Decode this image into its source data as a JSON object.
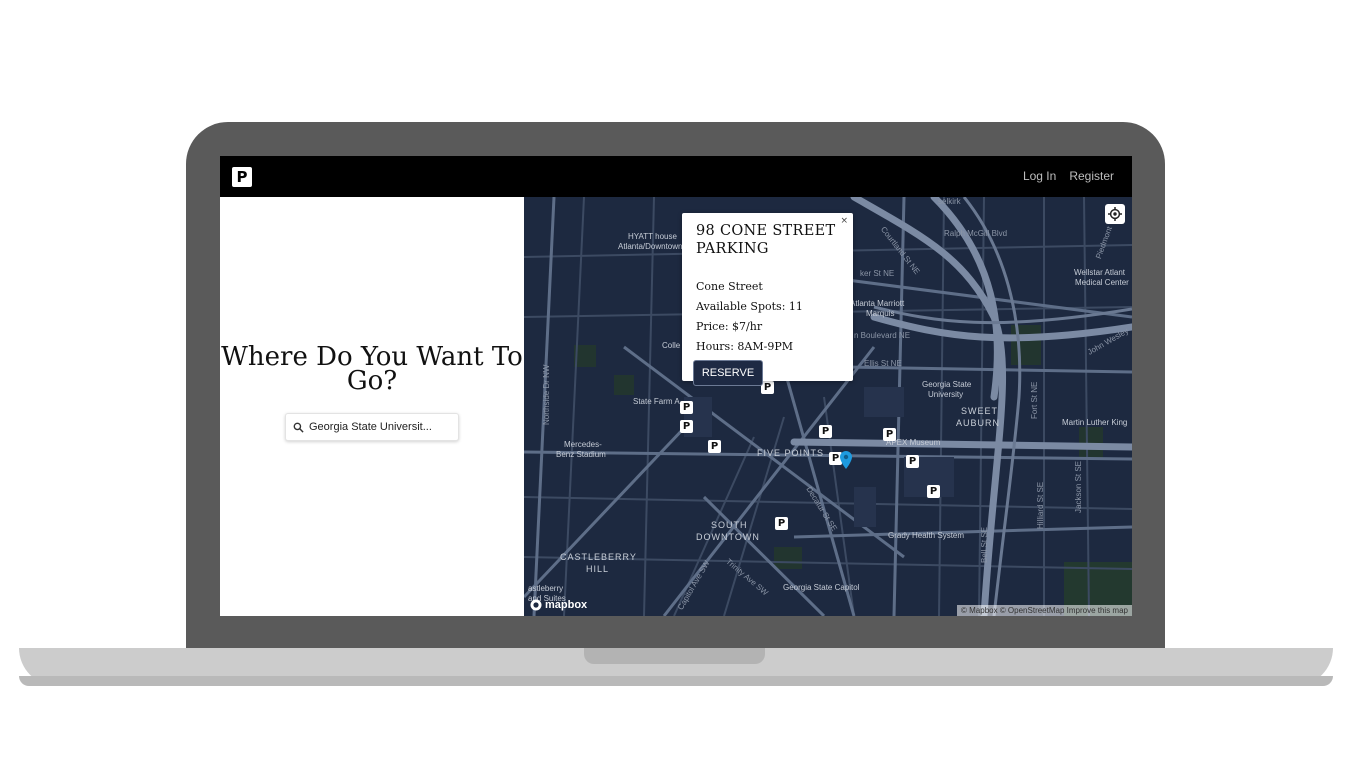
{
  "navbar": {
    "logo_letter": "P",
    "login_label": "Log In",
    "register_label": "Register"
  },
  "search": {
    "headline": "Where Do You Want To Go?",
    "value": "Georgia State Universit...",
    "placeholder": ""
  },
  "popup": {
    "close_symbol": "×",
    "title": "98 CONE STREET PARKING",
    "street": "Cone Street",
    "available_spots": "Available Spots: 11",
    "price": "Price: $7/hr",
    "hours": "Hours: 8AM-9PM",
    "reserve_label": "RESERVE"
  },
  "map": {
    "parking_marker_letter": "P",
    "labels": {
      "five_points": "FIVE POINTS",
      "sweet_auburn_1": "SWEET",
      "sweet_auburn_2": "AUBURN",
      "south_downtown_1": "SOUTH",
      "south_downtown_2": "DOWNTOWN",
      "castleberry_1": "CASTLEBERRY",
      "castleberry_2": "HILL",
      "hyatt_1": "HYATT house",
      "hyatt_2": "Atlanta/Downtown",
      "state_farm": "State Farm A",
      "mercedes_1": "Mercedes-",
      "mercedes_2": "Benz Stadium",
      "marriott_1": "Atlanta Marriott",
      "marriott_2": "Marquis",
      "gsu_1": "Georgia State",
      "gsu_2": "University",
      "apex": "APEX Museum",
      "grady": "Grady Health System",
      "capitol": "Georgia State Capitol",
      "wellstar_1": "Wellstar Atlant",
      "wellstar_2": "Medical Center",
      "mlk": "Martin Luther King",
      "castleberry_suites_1": "astleberry",
      "castleberry_suites_2": "and Suites",
      "colle": "Colle",
      "ralph": "Ralph McGill Blvd",
      "ellis": "Ellis St NE",
      "boulevard": "n Boulevard NE",
      "decatur": "Decatur St SE",
      "courtland": "Courtland St NE",
      "john_wesley": "John Wesley",
      "piedmont": "Piedmont",
      "fort": "Fort St NE",
      "hilliard": "Hilliard St SE",
      "bell": "Bell St SE",
      "jackson": "Jackson St SE",
      "capitol_ave": "Capitol Ave SW",
      "trinity": "Trinity Ave SW",
      "northside": "Northside Dr NW",
      "selkirk": "selkirk",
      "baker": "ker St NE"
    },
    "mapbox_logo": "mapbox",
    "attribution": "© Mapbox © OpenStreetMap Improve this map"
  },
  "colors": {
    "map_background": "#1d2940",
    "road": "#5e6e88",
    "highway": "#7b8aa3",
    "reserve_button": "#1e2a44",
    "map_pin": "#1e9be0"
  }
}
